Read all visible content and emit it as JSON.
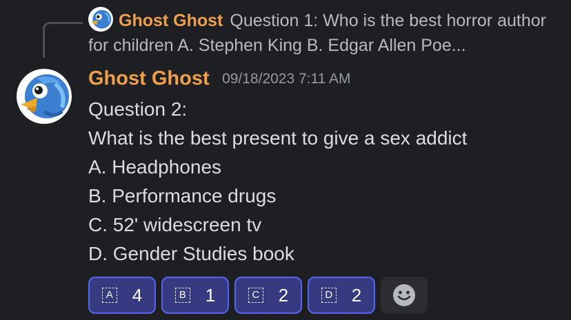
{
  "reply": {
    "author": "Ghost Ghost",
    "preview": "Question 1: Who is the best horror author for children A. Stephen King  B. Edgar Allen Poe...",
    "avatar_icon": "bluebird-icon"
  },
  "message": {
    "author": "Ghost Ghost",
    "timestamp": "09/18/2023 7:11 AM",
    "avatar_icon": "bluebird-icon",
    "lines": [
      "Question 2:",
      "What is the best present to give a sex addict",
      "A. Headphones",
      "B. Performance drugs",
      "C. 52' widescreen tv",
      "D. Gender Studies book"
    ]
  },
  "reactions": [
    {
      "letter": "A",
      "count": "4"
    },
    {
      "letter": "B",
      "count": "1"
    },
    {
      "letter": "C",
      "count": "2"
    },
    {
      "letter": "D",
      "count": "2"
    }
  ],
  "add_reaction_icon": "smiley-icon",
  "colors": {
    "author": "#f0a04b",
    "reaction_border": "#5865f2",
    "background": "#1e1f22"
  }
}
